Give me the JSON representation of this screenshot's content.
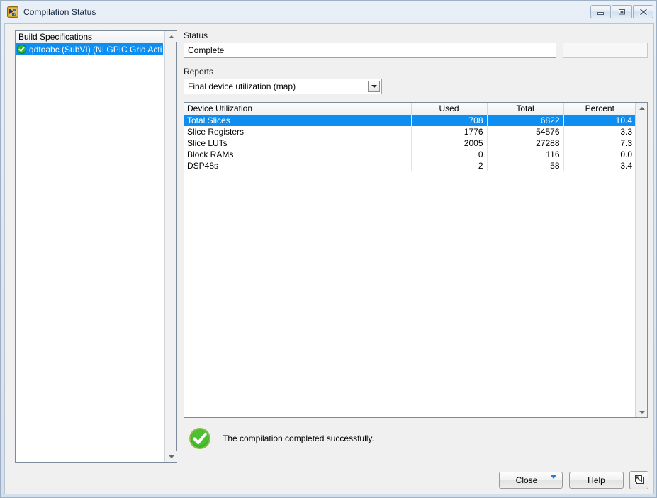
{
  "window": {
    "title": "Compilation Status",
    "icon": "labview-compile-icon",
    "controls": [
      {
        "name": "minimize-button",
        "glyph": "minimize-icon"
      },
      {
        "name": "maximize-button",
        "glyph": "maximize-icon"
      },
      {
        "name": "close-button",
        "glyph": "close-icon"
      }
    ]
  },
  "build_specifications": {
    "header": "Build Specifications",
    "items": [
      {
        "label": "qdtoabc (SubVI) (NI GPIC Grid Acti",
        "status_icon": "green-check-icon",
        "selected": true
      }
    ]
  },
  "status": {
    "label": "Status",
    "value": "Complete",
    "progress_value": ""
  },
  "reports": {
    "label": "Reports",
    "selected": "Final device utilization (map)",
    "options": [
      "Final device utilization (map)"
    ]
  },
  "table": {
    "columns": [
      "Device Utilization",
      "Used",
      "Total",
      "Percent"
    ],
    "rows": [
      {
        "name": "Total Slices",
        "used": "708",
        "total": "6822",
        "percent": "10.4",
        "selected": true
      },
      {
        "name": "Slice Registers",
        "used": "1776",
        "total": "54576",
        "percent": "3.3",
        "selected": false
      },
      {
        "name": "Slice LUTs",
        "used": "2005",
        "total": "27288",
        "percent": "7.3",
        "selected": false
      },
      {
        "name": "Block RAMs",
        "used": "0",
        "total": "116",
        "percent": "0.0",
        "selected": false
      },
      {
        "name": "DSP48s",
        "used": "2",
        "total": "58",
        "percent": "3.4",
        "selected": false
      }
    ]
  },
  "result": {
    "icon": "green-check-circle-icon",
    "message": "The compilation completed successfully."
  },
  "buttons": {
    "close": "Close",
    "close_dropdown_icon": "chevron-down-icon",
    "help": "Help",
    "expand_icon": "restore-window-icon"
  },
  "colors": {
    "selection_blue": "#0d8ef0",
    "success_green": "#2db52d",
    "title_text": "#12263f",
    "accent_arrow": "#1e7fd4"
  }
}
